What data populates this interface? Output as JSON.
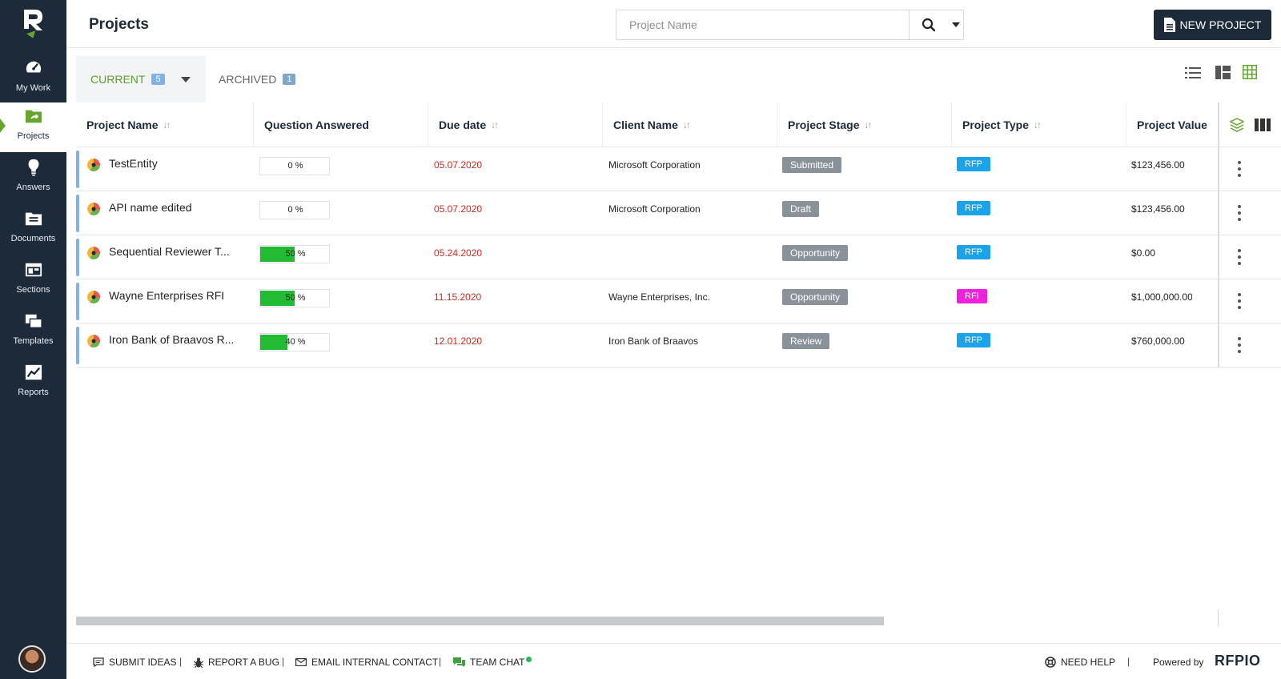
{
  "sidebar": {
    "items": [
      {
        "label": "My Work",
        "icon": "speedometer-icon"
      },
      {
        "label": "Projects",
        "icon": "folder-share-icon"
      },
      {
        "label": "Answers",
        "icon": "lightbulb-icon"
      },
      {
        "label": "Documents",
        "icon": "folder-doc-icon"
      },
      {
        "label": "Sections",
        "icon": "sections-icon"
      },
      {
        "label": "Templates",
        "icon": "templates-icon"
      },
      {
        "label": "Reports",
        "icon": "chart-icon"
      }
    ],
    "active": "Projects"
  },
  "header": {
    "title": "Projects",
    "search_placeholder": "Project Name",
    "new_project_label": "NEW PROJECT"
  },
  "tabs": {
    "current": {
      "label": "CURRENT",
      "count": "5"
    },
    "archived": {
      "label": "ARCHIVED",
      "count": "1"
    }
  },
  "table": {
    "columns": [
      "Project Name",
      "Question Answered",
      "Due date",
      "Client Name",
      "Project Stage",
      "Project Type",
      "Project Value"
    ],
    "rows": [
      {
        "name": "TestEntity",
        "progress": 0,
        "progress_label": "0 %",
        "due": "05.07.2020",
        "client": "Microsoft Corporation",
        "stage": "Submitted",
        "type": "RFP",
        "value": "$123,456.00"
      },
      {
        "name": "API name edited",
        "progress": 0,
        "progress_label": "0 %",
        "due": "05.07.2020",
        "client": "Microsoft Corporation",
        "stage": "Draft",
        "type": "RFP",
        "value": "$123,456.00"
      },
      {
        "name": "Sequential Reviewer T...",
        "progress": 50,
        "progress_label": "50 %",
        "due": "05.24.2020",
        "client": "",
        "stage": "Opportunity",
        "type": "RFP",
        "value": "$0.00"
      },
      {
        "name": "Wayne Enterprises RFI",
        "progress": 50,
        "progress_label": "50 %",
        "due": "11.15.2020",
        "client": "Wayne Enterprises, Inc.",
        "stage": "Opportunity",
        "type": "RFI",
        "value": "$1,000,000.00"
      },
      {
        "name": "Iron Bank of Braavos R...",
        "progress": 40,
        "progress_label": "40 %",
        "due": "12.01.2020",
        "client": "Iron Bank of Braavos",
        "stage": "Review",
        "type": "RFP",
        "value": "$760,000.00"
      }
    ]
  },
  "colors": {
    "sidebar_bg": "#1d2a3a",
    "accent_green": "#66a62f",
    "progress_green": "#22bb33",
    "due_red": "#d0281f",
    "type_rfp": "#1aa3e8",
    "type_rfi": "#ee22dd",
    "stage_gray": "#8a9299"
  },
  "footer": {
    "submit_ideas": "SUBMIT IDEAS",
    "report_bug": "REPORT A BUG",
    "email_contact": "EMAIL INTERNAL CONTACT",
    "team_chat": "TEAM CHAT",
    "need_help": "NEED HELP",
    "powered_by": "Powered by",
    "brand": "RFPIO"
  }
}
